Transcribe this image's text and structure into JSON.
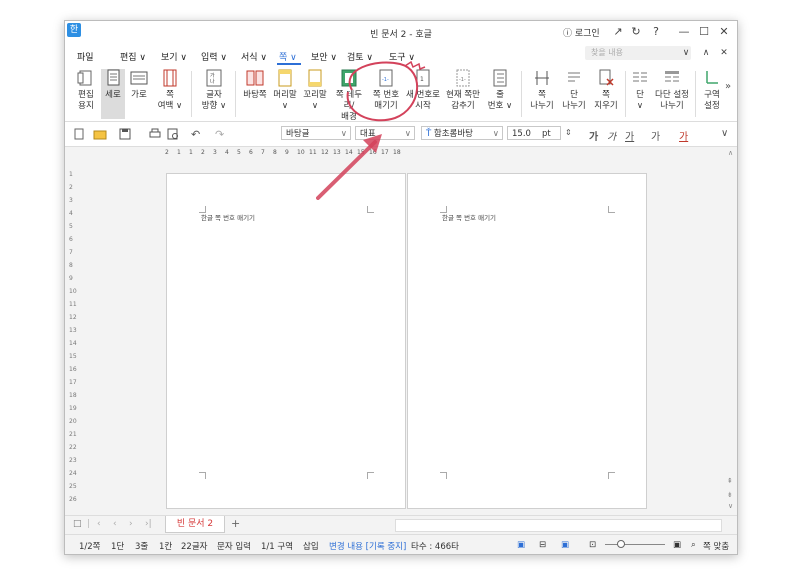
{
  "window": {
    "title": "빈 문서 2 - 호글",
    "login": "ⓘ 로그인",
    "app_icon": "한",
    "controls": [
      "↗",
      "↻",
      "?",
      "—",
      "☐",
      "✕"
    ]
  },
  "menu": {
    "items": [
      "파일",
      "편집 ∨",
      "보기 ∨",
      "입력 ∨",
      "서식 ∨",
      "쪽 ∨",
      "보안 ∨",
      "검토 ∨",
      "도구 ∨"
    ],
    "active_index": 5,
    "search_placeholder": "찾을 내용",
    "right_icons": [
      "∨",
      "∧",
      "✕"
    ]
  },
  "ribbon": {
    "buttons": [
      {
        "label1": "편집",
        "label2": "용지",
        "icon": "page-setup-icon"
      },
      {
        "label1": "세로",
        "label2": "",
        "icon": "portrait-icon",
        "active": true
      },
      {
        "label1": "가로",
        "label2": "",
        "icon": "landscape-icon"
      },
      {
        "label1": "쪽",
        "label2": "여백 ∨",
        "icon": "margin-icon"
      },
      {
        "label1": "글자",
        "label2": "방향 ∨",
        "icon": "text-direction-icon"
      },
      {
        "label1": "바탕쪽",
        "label2": "",
        "icon": "master-page-icon"
      },
      {
        "label1": "머리말",
        "label2": "∨",
        "icon": "header-icon"
      },
      {
        "label1": "꼬리말",
        "label2": "∨",
        "icon": "footer-icon"
      },
      {
        "label1": "쪽 테두리/",
        "label2": "배경",
        "icon": "page-border-icon"
      },
      {
        "label1": "쪽 번호",
        "label2": "매기기",
        "icon": "page-number-icon"
      },
      {
        "label1": "새 번호로",
        "label2": "시작",
        "icon": "new-number-icon"
      },
      {
        "label1": "현재 쪽만",
        "label2": "감추기",
        "icon": "hide-page-icon"
      },
      {
        "label1": "줄",
        "label2": "번호 ∨",
        "icon": "line-number-icon"
      },
      {
        "label1": "쪽",
        "label2": "나누기",
        "icon": "page-break-icon"
      },
      {
        "label1": "단",
        "label2": "나누기",
        "icon": "column-break-icon"
      },
      {
        "label1": "쪽",
        "label2": "지우기",
        "icon": "delete-page-icon"
      },
      {
        "label1": "단",
        "label2": "∨",
        "icon": "columns-icon"
      },
      {
        "label1": "다단 설정",
        "label2": "나누기",
        "icon": "multi-column-icon"
      },
      {
        "label1": "구역",
        "label2": "설정",
        "icon": "section-icon"
      }
    ],
    "more": "»"
  },
  "toolbar": {
    "style_value": "바탕글",
    "lang_value": "대표",
    "font_value": "함초롬바탕",
    "size_value": "15.0",
    "size_unit": "pt",
    "format_glyphs": [
      "가",
      "가",
      "가",
      "가",
      "가"
    ]
  },
  "ruler": {
    "h_numbers": [
      "2",
      "1",
      "1",
      "2",
      "3",
      "4",
      "5",
      "6",
      "7",
      "8",
      "9",
      "10",
      "11",
      "12",
      "13",
      "14",
      "15",
      "16",
      "17",
      "18"
    ],
    "v_numbers": [
      "1",
      "2",
      "3",
      "4",
      "5",
      "6",
      "7",
      "8",
      "9",
      "10",
      "11",
      "12",
      "13",
      "14",
      "15",
      "16",
      "17",
      "18",
      "19",
      "20",
      "21",
      "22",
      "23",
      "24",
      "25",
      "26"
    ]
  },
  "pages": [
    {
      "text": "한글 쪽 번호 매기기"
    },
    {
      "text": "한글 쪽 번호 매기기"
    }
  ],
  "tabs": {
    "doc_tab": "빈 문서 2",
    "add": "+",
    "nav": [
      "□",
      "|",
      "‹",
      "‹",
      "›",
      "›|"
    ]
  },
  "status": {
    "page": "1/2쪽",
    "column": "1단",
    "line": "3줄",
    "col": "1칸",
    "chars": "22글자",
    "mode": "문자 입력",
    "section": "1/1 구역",
    "insert": "삽입",
    "track": "변경 내용 [기록 중지]",
    "keystrokes": "타수 : 466타",
    "zoom_label": "쪽 맞춤"
  },
  "colors": {
    "accent": "#2d6fd6",
    "annotation": "#d3425b",
    "tab_text": "#d63a3a"
  }
}
